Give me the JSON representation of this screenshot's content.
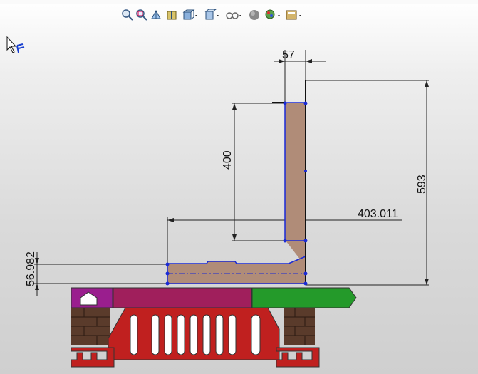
{
  "toolbar": {
    "tools": [
      {
        "name": "zoom-to-fit-icon"
      },
      {
        "name": "zoom-to-area-icon"
      },
      {
        "name": "previous-view-icon"
      },
      {
        "name": "section-view-icon"
      },
      {
        "name": "view-orientation-icon"
      },
      {
        "name": "display-style-icon"
      },
      {
        "name": "hide-show-items-icon"
      },
      {
        "name": "edit-appearance-icon"
      },
      {
        "name": "apply-scene-icon"
      },
      {
        "name": "view-settings-icon"
      }
    ]
  },
  "dimensions": {
    "width_top": "57",
    "height_inner": "400",
    "height_total": "593",
    "length_horizontal": "403.011",
    "thickness_bottom": "56.982"
  },
  "colors": {
    "sketch_fill": "#b08c78",
    "sketch_line": "#1a2ad6",
    "magenta": "#a01f5c",
    "purple": "#9a1e8e",
    "green": "#249a2a",
    "red": "#c0201f",
    "brick": "#5a3b2b"
  }
}
